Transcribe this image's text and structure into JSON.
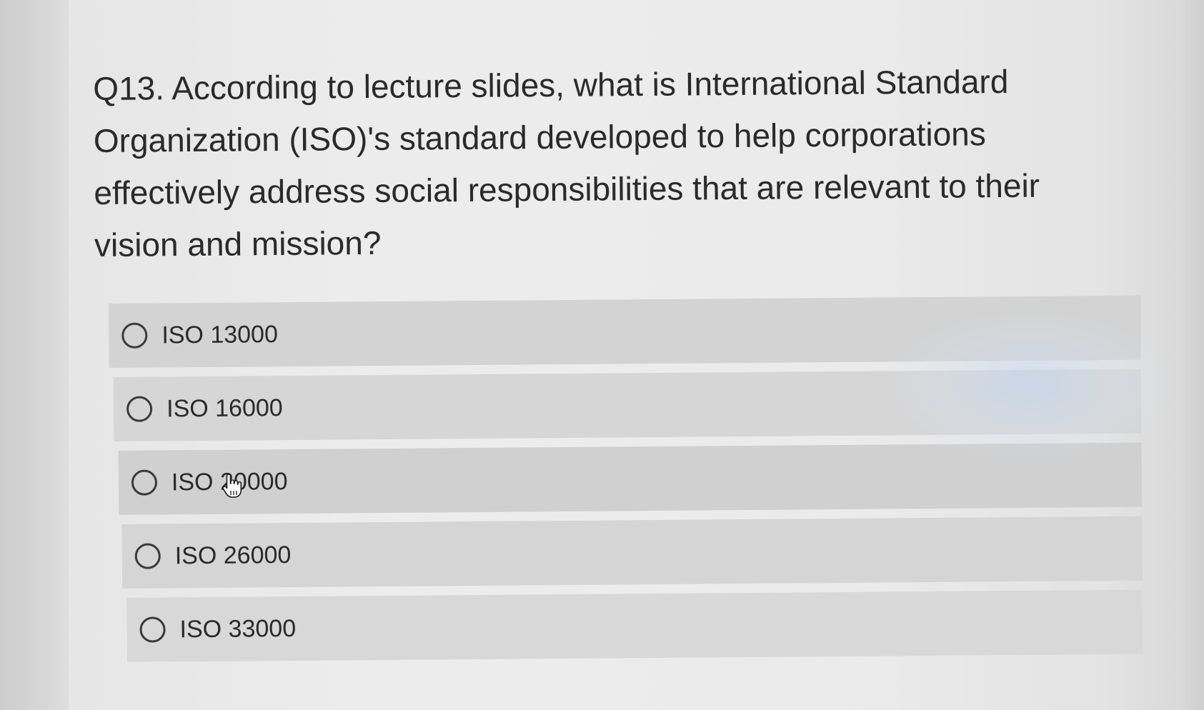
{
  "quiz": {
    "question": "Q13. According to lecture slides, what is International Standard Organization (ISO)'s standard developed to help corporations effectively address social responsibilities that are relevant to their vision and mission?",
    "options": [
      {
        "label": "ISO 13000",
        "selected": false
      },
      {
        "label": "ISO 16000",
        "selected": false
      },
      {
        "label": "ISO 20000",
        "selected": false
      },
      {
        "label": "ISO 26000",
        "selected": false
      },
      {
        "label": "ISO 33000",
        "selected": false
      }
    ]
  },
  "cursor": {
    "icon": "pointer-hand-icon"
  },
  "colors": {
    "text": "#2a2a2a",
    "option_background": "#d4d4d4",
    "page_background": "#ececec"
  }
}
